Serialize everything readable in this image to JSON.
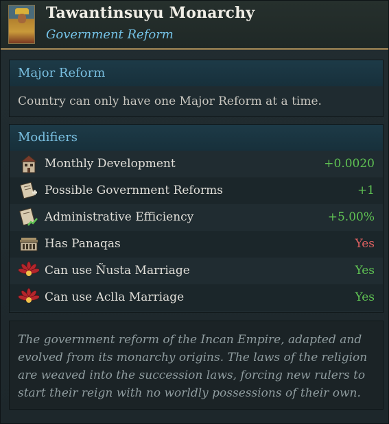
{
  "header": {
    "title": "Tawantinsuyu Monarchy",
    "subtitle": "Government Reform"
  },
  "major_reform": {
    "heading": "Major Reform",
    "text": "Country can only have one Major Reform at a time."
  },
  "modifiers": {
    "heading": "Modifiers",
    "rows": [
      {
        "label": "Monthly Development",
        "value": "+0.0020",
        "icon": "development-building-icon",
        "color": "#5fc253"
      },
      {
        "label": "Possible Government Reforms",
        "value": "+1",
        "icon": "scroll-plus-icon",
        "color": "#5fc253"
      },
      {
        "label": "Administrative Efficiency",
        "value": "+5.00%",
        "icon": "scroll-chart-icon",
        "color": "#5fc253"
      },
      {
        "label": "Has Panaqas",
        "value": "Yes",
        "icon": "palace-icon",
        "color": "#e06161"
      },
      {
        "label": "Can use Ñusta Marriage",
        "value": "Yes",
        "icon": "feather-crest-icon",
        "color": "#5fc253"
      },
      {
        "label": "Can use Aclla Marriage",
        "value": "Yes",
        "icon": "feather-crest-icon",
        "color": "#5fc253"
      }
    ]
  },
  "description": "The government reform of the Incan Empire, adapted and evolved from its monarchy origins. The laws of the religion are weaved into the succession laws, forcing new rulers to start their reign with no worldly possessions of their own."
}
